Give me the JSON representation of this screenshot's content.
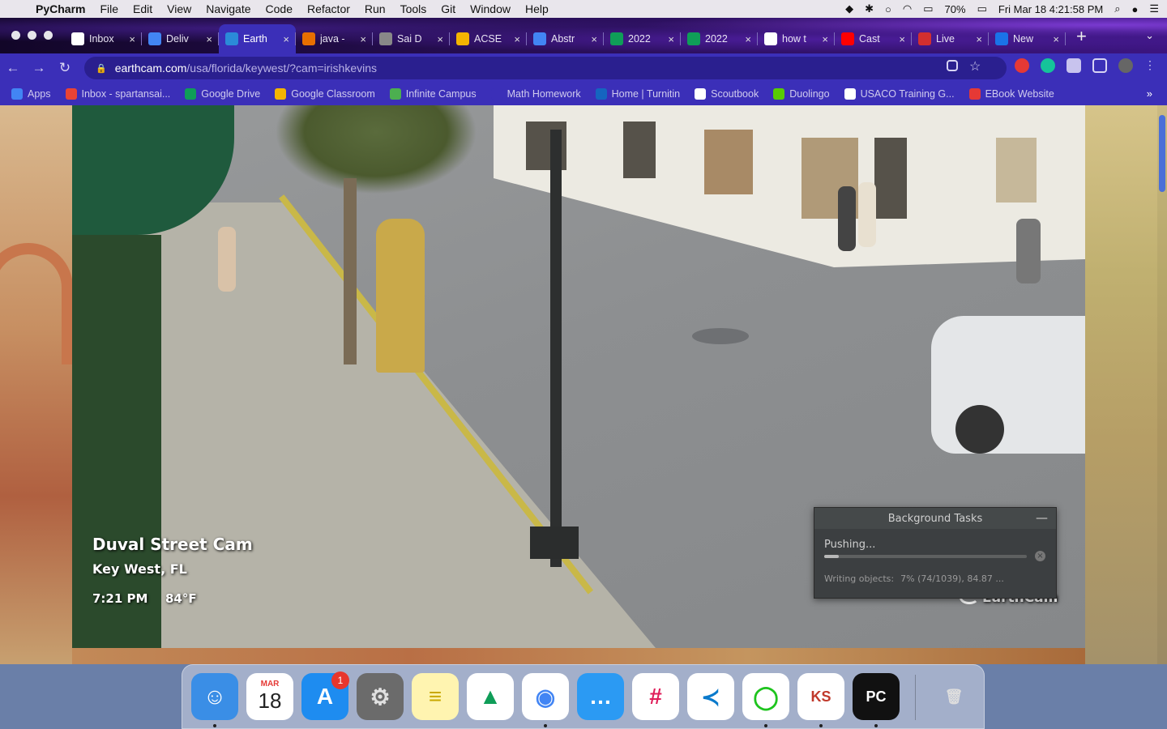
{
  "menubar": {
    "app_name": "PyCharm",
    "items": [
      "File",
      "Edit",
      "View",
      "Navigate",
      "Code",
      "Refactor",
      "Run",
      "Tools",
      "Git",
      "Window",
      "Help"
    ],
    "battery": "70%",
    "clock": "Fri Mar 18  4:21:58 PM"
  },
  "tabs": [
    {
      "label": "Inbox",
      "icon": "gmail-icon",
      "color": "#ffffff"
    },
    {
      "label": "Deliv",
      "icon": "google-docs-icon",
      "color": "#4285f4"
    },
    {
      "label": "Earth",
      "icon": "earthcam-icon",
      "color": "#2b8ad8"
    },
    {
      "label": "java -",
      "icon": "java-icon",
      "color": "#e76f00"
    },
    {
      "label": "Sai D",
      "icon": "graduation-icon",
      "color": "#888888"
    },
    {
      "label": "ACSE",
      "icon": "google-slides-icon",
      "color": "#f4b400"
    },
    {
      "label": "Abstr",
      "icon": "google-docs-icon",
      "color": "#4285f4"
    },
    {
      "label": "2022",
      "icon": "google-drive-icon",
      "color": "#0f9d58"
    },
    {
      "label": "2022",
      "icon": "google-drive-icon",
      "color": "#0f9d58"
    },
    {
      "label": "how t",
      "icon": "google-icon",
      "color": "#ffffff"
    },
    {
      "label": "Cast",
      "icon": "youtube-icon",
      "color": "#ff0000"
    },
    {
      "label": "Live",
      "icon": "live-icon",
      "color": "#d32f2f"
    },
    {
      "label": "New",
      "icon": "new-tab-icon",
      "color": "#1a73e8"
    }
  ],
  "active_tab_index": 2,
  "address": {
    "host": "earthcam.com",
    "path": "/usa/florida/keywest/?cam=irishkevins"
  },
  "bookmarks": [
    {
      "label": "Apps",
      "color": "#4285f4"
    },
    {
      "label": "Inbox - spartansai...",
      "color": "#ea4335"
    },
    {
      "label": "Google Drive",
      "color": "#0f9d58"
    },
    {
      "label": "Google Classroom",
      "color": "#f4b400"
    },
    {
      "label": "Infinite Campus",
      "color": "#4caf50"
    },
    {
      "label": "Math Homework",
      "color": "#3b2fb8"
    },
    {
      "label": "Home | Turnitin",
      "color": "#1565c0"
    },
    {
      "label": "Scoutbook",
      "color": "#ffffff"
    },
    {
      "label": "Duolingo",
      "color": "#58cc02"
    },
    {
      "label": "USACO Training G...",
      "color": "#ffffff"
    },
    {
      "label": "EBook Website",
      "color": "#e53935"
    }
  ],
  "video_overlay": {
    "title": "Duval Street Cam",
    "location": "Key West, FL",
    "time": "7:21 PM",
    "temperature": "84°F",
    "watermark": "EarthCam"
  },
  "background_tasks": {
    "title": "Background Tasks",
    "status": "Pushing...",
    "detail_label": "Writing objects:",
    "detail_value": "7% (74/1039), 84.87 ...",
    "progress_fraction": 0.07
  },
  "dock": [
    {
      "name": "finder",
      "glyph": "☺",
      "bg": "#3a8ee6",
      "fg": "#ffffff",
      "running": true
    },
    {
      "name": "calendar",
      "glyph": "18",
      "bg": "#ffffff",
      "fg": "#222222",
      "running": false,
      "month": "MAR"
    },
    {
      "name": "app-store",
      "glyph": "A",
      "bg": "#1e8cf0",
      "fg": "#ffffff",
      "running": false,
      "badge": "1"
    },
    {
      "name": "system-preferences",
      "glyph": "⚙",
      "bg": "#6b6b6b",
      "fg": "#e0e0e0",
      "running": false
    },
    {
      "name": "notes",
      "glyph": "≡",
      "bg": "#fff4b0",
      "fg": "#c9a800",
      "running": false
    },
    {
      "name": "google-drive",
      "glyph": "▲",
      "bg": "#ffffff",
      "fg": "#0f9d58",
      "running": false
    },
    {
      "name": "chrome",
      "glyph": "◉",
      "bg": "#ffffff",
      "fg": "#4285f4",
      "running": true
    },
    {
      "name": "messages",
      "glyph": "…",
      "bg": "#2b9af3",
      "fg": "#ffffff",
      "running": false
    },
    {
      "name": "slack",
      "glyph": "#",
      "bg": "#ffffff",
      "fg": "#e01e5a",
      "running": false
    },
    {
      "name": "vscode",
      "glyph": "≺",
      "bg": "#ffffff",
      "fg": "#0a7acc",
      "running": false
    },
    {
      "name": "circle-app",
      "glyph": "◯",
      "bg": "#ffffff",
      "fg": "#1ec41e",
      "running": true
    },
    {
      "name": "kslides",
      "glyph": "KS",
      "bg": "#ffffff",
      "fg": "#c0392b",
      "running": true
    },
    {
      "name": "pycharm",
      "glyph": "PC",
      "bg": "#111111",
      "fg": "#ffffff",
      "running": true
    },
    {
      "name": "trash",
      "glyph": "🗑",
      "bg": "transparent",
      "fg": "#dddddd",
      "running": false
    }
  ]
}
